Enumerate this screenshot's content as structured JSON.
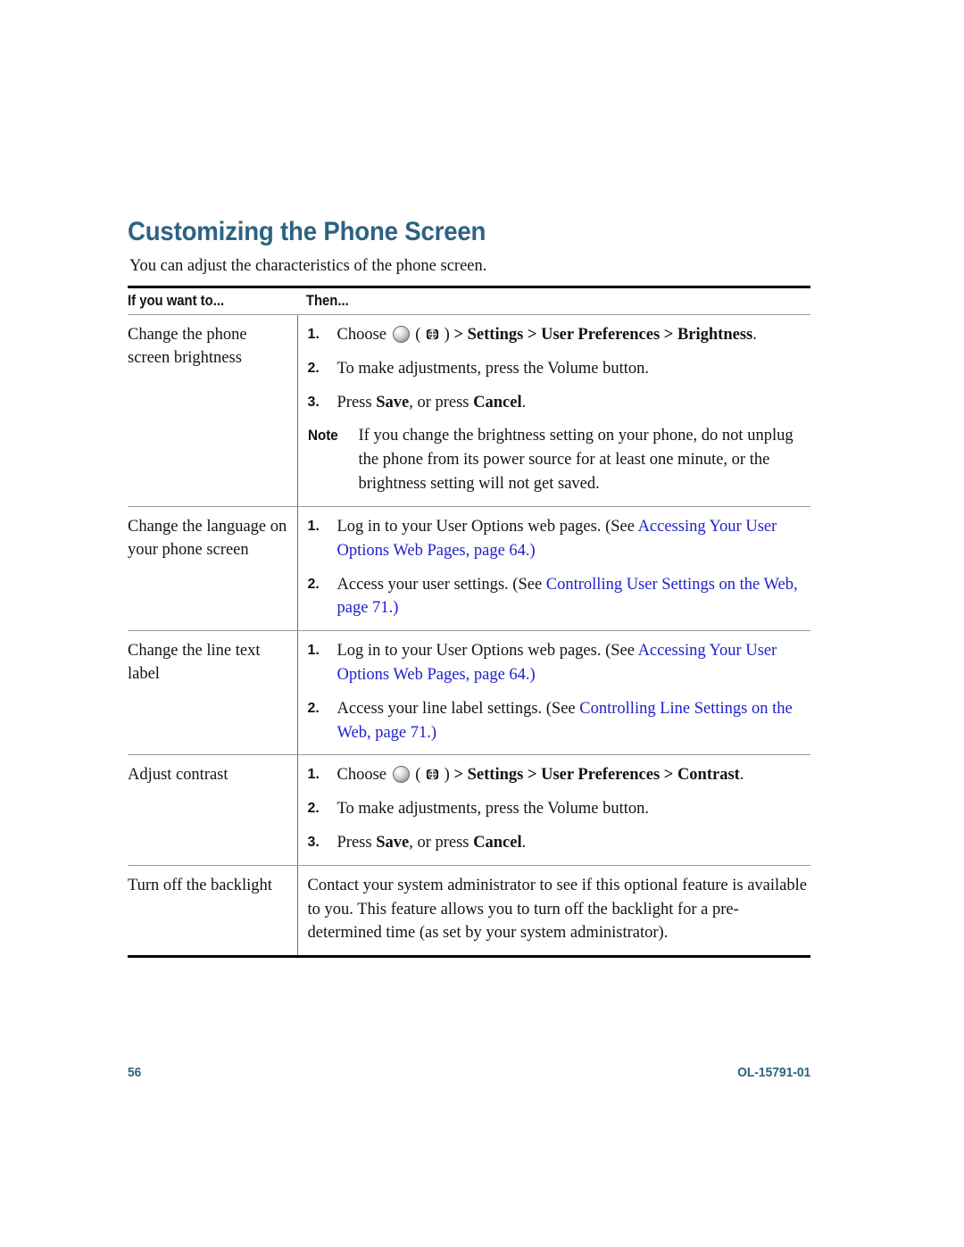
{
  "page": {
    "title": "Customizing the Phone Screen",
    "intro": "You can adjust the characteristics of the phone screen.",
    "title_color": "#2d6382",
    "link_color": "#2020cc"
  },
  "table": {
    "headers": {
      "col_a": "If you want to...",
      "col_b": "Then..."
    },
    "rows": [
      {
        "task": "Change the phone screen brightness",
        "steps": [
          {
            "num": "1.",
            "text": "Choose ( ) > Settings > User Preferences > Brightness."
          },
          {
            "num": "2.",
            "text": "To make adjustments, press the Volume button."
          },
          {
            "num": "3.",
            "text": "Press Save, or press Cancel."
          },
          {
            "num": "Note",
            "text": "If you change the brightness setting on your phone, do not unplug the phone from its power source for at least one minute, or the brightness setting will not get saved."
          }
        ]
      },
      {
        "task": "Change the language on your phone screen",
        "steps": [
          {
            "num": "1.",
            "text": "Log in to your User Options web pages. (See Accessing Your User Options Web Pages, page 64.)"
          },
          {
            "num": "2.",
            "text": "Access your user settings. (See Controlling User Settings on the Web, page 71.)"
          }
        ]
      },
      {
        "task": "Change the line text label",
        "steps": [
          {
            "num": "1.",
            "text": "Log in to your User Options web pages. (See Accessing Your User Options Web Pages, page 64.)"
          },
          {
            "num": "2.",
            "text": "Access your line label settings. (See Controlling Line Settings on the Web, page 71.)"
          }
        ]
      },
      {
        "task": "Adjust contrast",
        "steps": [
          {
            "num": "1.",
            "text": "Choose ( ) > Settings > User Preferences > Contrast."
          },
          {
            "num": "2.",
            "text": "To make adjustments, press the Volume button."
          },
          {
            "num": "3.",
            "text": "Press Save, or press Cancel."
          }
        ]
      },
      {
        "task": "Turn off the backlight",
        "steps": [
          {
            "num": "",
            "text": "Contact your system administrator to see if this optional feature is available to you. This feature allows you to turn off the backlight for a pre-determined time (as set by your system administrator)."
          }
        ]
      }
    ],
    "fragments": {
      "choose": "Choose",
      "paren_open": "(",
      "paren_close": ")",
      "nav_brightness": "> Settings > User Preferences > Brightness",
      "nav_contrast": "> Settings > User Preferences > Contrast",
      "period": ".",
      "volume_step": "To make adjustments, press the Volume button.",
      "press": "Press",
      "save": "Save",
      "or_press": ", or press",
      "cancel": "Cancel",
      "note_label": "Note",
      "note_text": "If you change the brightness setting on your phone, do not unplug the phone from its power source for at least one minute, or the brightness setting will not get saved.",
      "login_pre": "Log in to your User Options web pages. (See",
      "login_link": "Accessing Your User Options Web Pages, page 64",
      "close_paren": ".)",
      "user_settings_pre": "Access your user settings. (See",
      "user_settings_link": "Controlling User Settings on the Web, page 71",
      "line_settings_pre": "Access your line label settings. (See",
      "line_settings_link": "Controlling Line Settings on the Web, page 71",
      "backlight_text": "Contact your system administrator to see if this optional feature is available to you. This feature allows you to turn off the backlight for a pre-determined time (as set by your system administrator)."
    }
  },
  "footer": {
    "page_number": "56",
    "doc_id": "OL-15791-01"
  }
}
